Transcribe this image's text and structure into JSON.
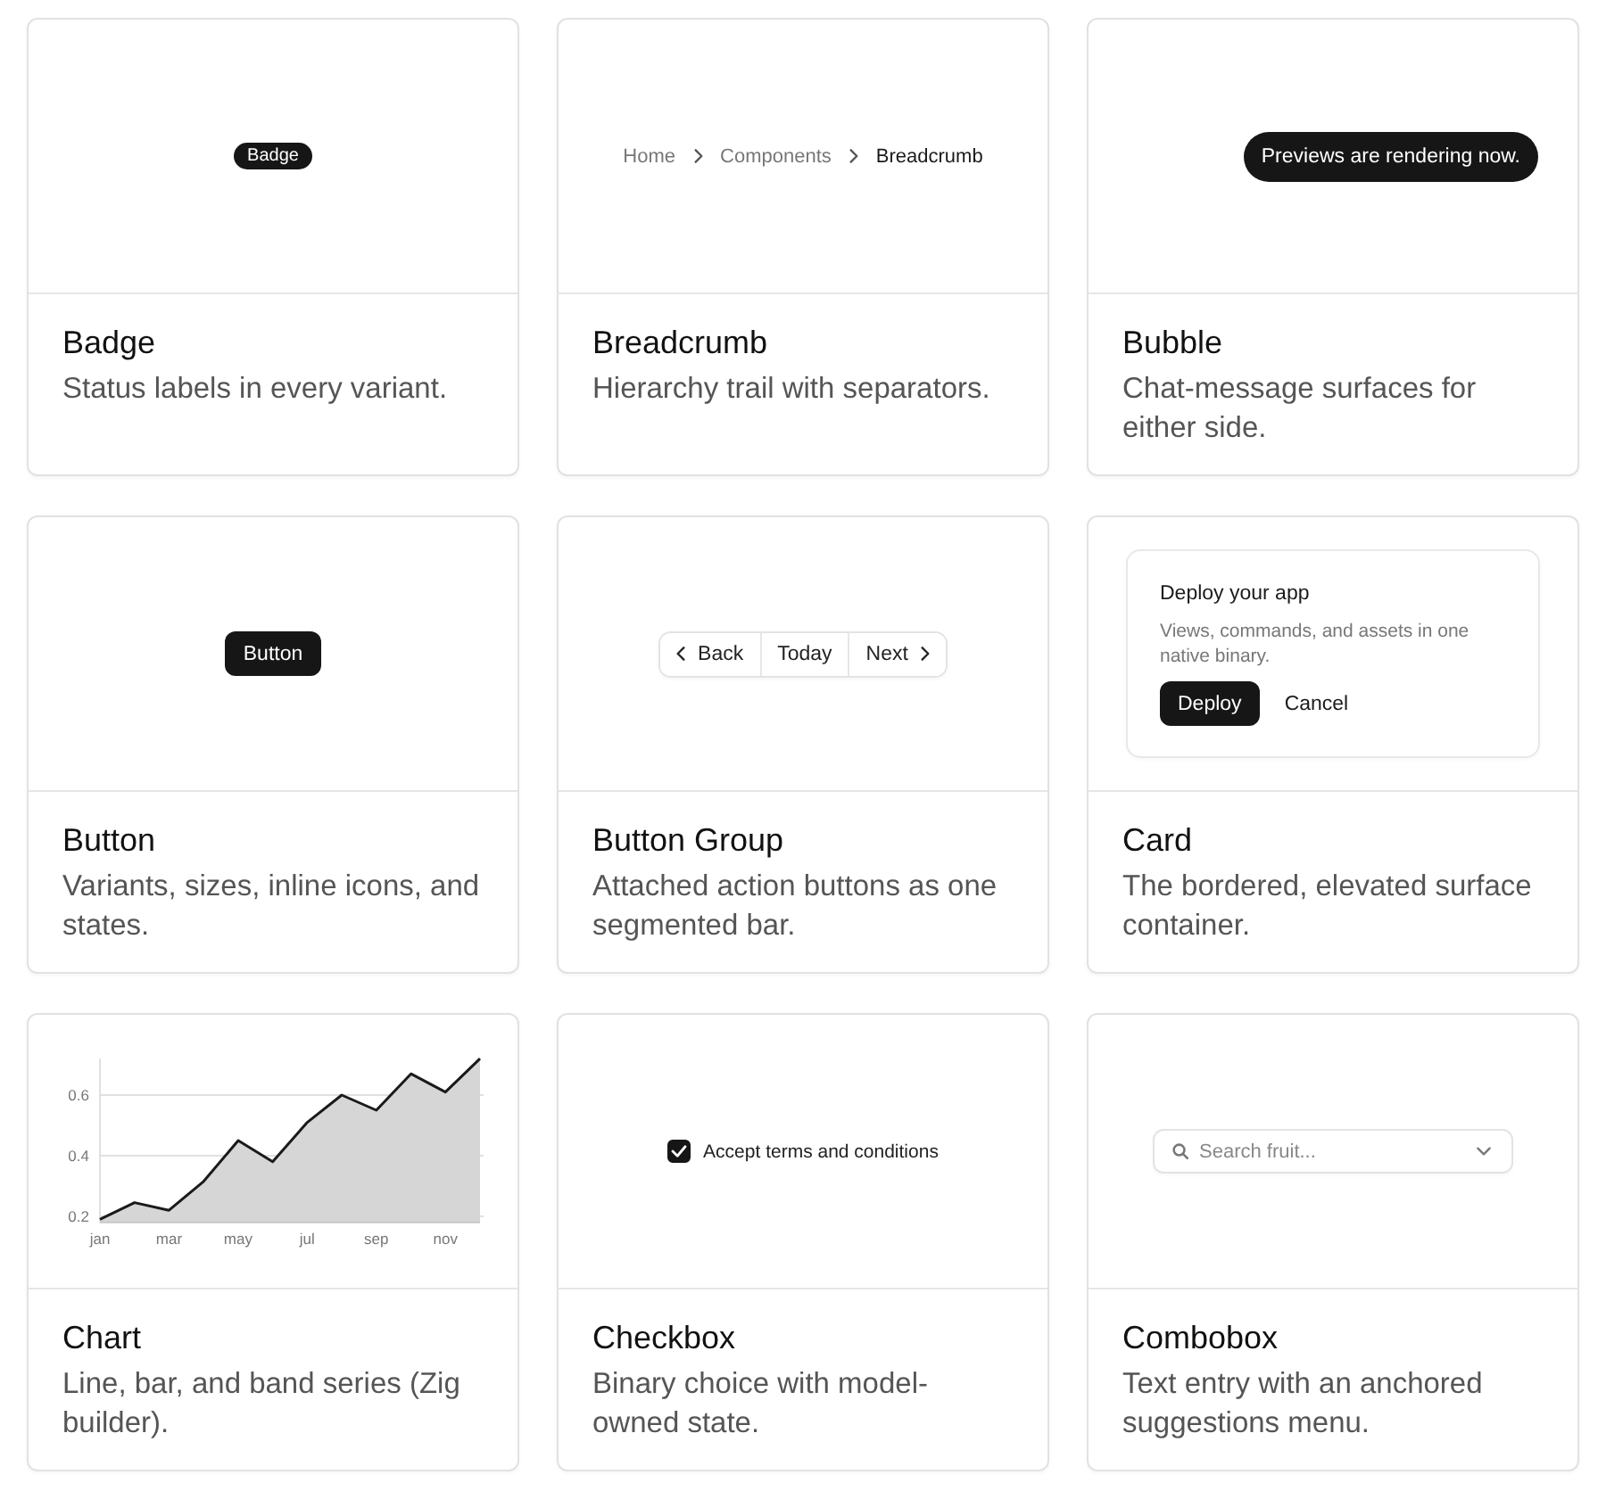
{
  "components": [
    {
      "title": "Badge",
      "description": "Status labels in every variant.",
      "preview": {
        "kind": "badge",
        "label": "Badge"
      }
    },
    {
      "title": "Breadcrumb",
      "description": "Hierarchy trail with separators.",
      "preview": {
        "kind": "breadcrumb",
        "items": [
          {
            "label": "Home",
            "current": false
          },
          {
            "label": "Components",
            "current": false
          },
          {
            "label": "Breadcrumb",
            "current": true
          }
        ]
      }
    },
    {
      "title": "Bubble",
      "description": "Chat-message surfaces for either side.",
      "preview": {
        "kind": "bubble",
        "text": "Previews are rendering now."
      }
    },
    {
      "title": "Button",
      "description": "Variants, sizes, inline icons, and states.",
      "preview": {
        "kind": "button",
        "label": "Button"
      }
    },
    {
      "title": "Button Group",
      "description": "Attached action buttons as one segmented bar.",
      "preview": {
        "kind": "button_group",
        "buttons": [
          "Back",
          "Today",
          "Next"
        ]
      }
    },
    {
      "title": "Card",
      "description": "The bordered, elevated surface container.",
      "preview": {
        "kind": "card",
        "title": "Deploy your app",
        "text": "Views, commands, and assets in one native binary.",
        "actions": [
          {
            "label": "Deploy",
            "kind": "primary"
          },
          {
            "label": "Cancel",
            "kind": "ghost"
          }
        ]
      }
    },
    {
      "title": "Chart",
      "description": "Line, bar, and band series (Zig builder).",
      "preview": {
        "kind": "chart",
        "chart_data": {
          "type": "area",
          "categories": [
            "jan",
            null,
            "mar",
            null,
            "may",
            null,
            "jul",
            null,
            "sep",
            null,
            "nov",
            null
          ],
          "values": [
            0.19,
            0.245,
            0.22,
            0.315,
            0.45,
            0.38,
            0.51,
            0.6,
            0.55,
            0.67,
            0.61,
            0.72
          ],
          "ylim": [
            0.18,
            0.72
          ],
          "yticks": [
            0.2,
            0.4,
            0.6
          ],
          "grid": true
        }
      }
    },
    {
      "title": "Checkbox",
      "description": "Binary choice with model-owned state.",
      "preview": {
        "kind": "checkbox",
        "label": "Accept terms and conditions",
        "checked": true
      }
    },
    {
      "title": "Combobox",
      "description": "Text entry with an anchored suggestions menu.",
      "preview": {
        "kind": "combobox",
        "placeholder": "Search fruit..."
      }
    }
  ]
}
